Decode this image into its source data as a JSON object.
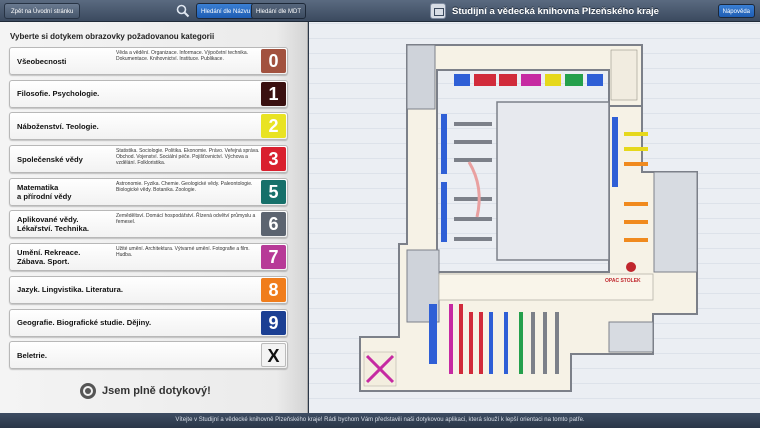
{
  "header": {
    "back_label": "Zpět na Úvodní stránku",
    "mode_active": "Hledání dle Názvu",
    "mode_inactive": "Hledání dle MDT",
    "title": "Studijní a vědecká knihovna Plzeňského kraje",
    "help_label": "Nápověda"
  },
  "panel": {
    "heading": "Vyberte si dotykem obrazovky požadovanou kategorii",
    "categories": [
      {
        "name": "Všeobecnosti",
        "desc": "Věda a vědění. Organizace. Informace. Výpočetní technika. Dokumentace. Knihovnictví. Instituce. Publikace.",
        "num": "0",
        "color": "#a2523f"
      },
      {
        "name": "Filosofie. Psychologie.",
        "desc": "",
        "num": "1",
        "color": "#3a1010"
      },
      {
        "name": "Náboženství. Teologie.",
        "desc": "",
        "num": "2",
        "color": "#e9e323"
      },
      {
        "name": "Společenské vědy",
        "desc": "Statistika. Sociologie. Politika. Ekonomie. Právo. Veřejná správa. Obchod. Vojenství. Sociální péče. Pojišťovnictví. Výchova a vzdělání. Folkloristika.",
        "num": "3",
        "color": "#d9202e"
      },
      {
        "name": "Matematika\na přírodní vědy",
        "desc": "Astronomie. Fyzika. Chemie. Geologické vědy. Paleontologie. Biologické vědy. Botanika. Zoologie.",
        "num": "5",
        "color": "#16706a"
      },
      {
        "name": "Aplikované vědy.\nLékařství. Technika.",
        "desc": "Zeměděltsví. Domácí hospodářství. Řízená odvětví průmyslu a řemesel.",
        "num": "6",
        "color": "#5c6470"
      },
      {
        "name": "Umění. Rekreace.\nZábava. Sport.",
        "desc": "Užité umění. Architektura. Výtvarné umění. Fotografie a film. Hudba.",
        "num": "7",
        "color": "#b73a97"
      },
      {
        "name": "Jazyk. Lingvistika. Literatura.",
        "desc": "",
        "num": "8",
        "color": "#f07d1c"
      },
      {
        "name": "Geografie. Biografické studie. Dějiny.",
        "desc": "",
        "num": "9",
        "color": "#1b3f93"
      },
      {
        "name": "Beletrie.",
        "desc": "",
        "num": "X",
        "color": "#f3f3f3",
        "text_color": "#111"
      }
    ],
    "touch_label": "Jsem plně dotykový!"
  },
  "map": {
    "labels": [
      {
        "id": "stamp",
        "text": "OPAC STOLEK"
      }
    ],
    "colors": {
      "wall": "#7c8089",
      "floor": "#f6f2e6",
      "courtyard": "#e7e9ee",
      "blue": "#2f5fd6",
      "red": "#d12b3b",
      "magenta": "#c62aa2",
      "yellow": "#e6d81c",
      "green": "#25a04c",
      "orange": "#f08a1e"
    }
  },
  "footer": {
    "text": "Vítejte v Studijní a vědecké knihovně Plzeňského kraje! Rádi bychom Vám představili naši dotykovou aplikaci, která slouží k lepší orientaci na tomto patře."
  }
}
